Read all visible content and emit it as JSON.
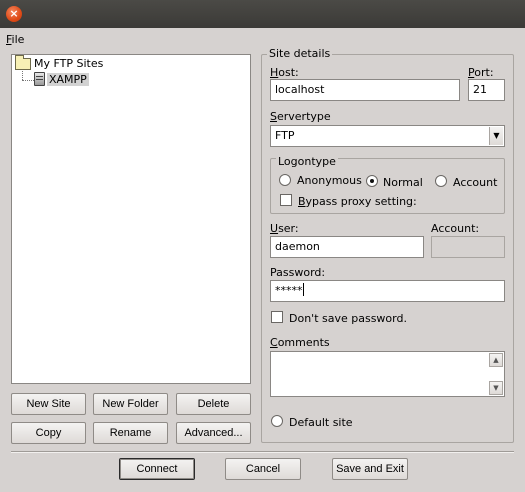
{
  "window": {
    "close_glyph": "×"
  },
  "menu": {
    "file": "File"
  },
  "tree": {
    "root_label": "My FTP Sites",
    "child_label": "XAMPP"
  },
  "left_buttons": {
    "new_site": "New Site",
    "new_folder": "New Folder",
    "delete": "Delete",
    "copy": "Copy",
    "rename": "Rename",
    "advanced": "Advanced..."
  },
  "site_details": {
    "group_label": "Site details",
    "host_label": "Host:",
    "host_value": "localhost",
    "port_label": "Port:",
    "port_value": "21",
    "servertype_label": "Servertype",
    "servertype_value": "FTP",
    "logontype_label": "Logontype",
    "logon_options": [
      "Anonymous",
      "Normal",
      "Account"
    ],
    "logon_selected": "Normal",
    "bypass_proxy_label": "Bypass proxy setting:",
    "bypass_proxy_checked": false,
    "user_label": "User:",
    "user_value": "daemon",
    "account_label": "Account:",
    "account_value": "",
    "password_label": "Password:",
    "password_value": "*****",
    "dont_save_password_label": "Don't save password.",
    "dont_save_password_checked": false,
    "comments_label": "Comments",
    "comments_value": "",
    "default_site_label": "Default site",
    "default_site_checked": false
  },
  "bottom_buttons": {
    "connect": "Connect",
    "cancel": "Cancel",
    "save_and_exit": "Save and Exit"
  },
  "colors": {
    "window_bg": "#d6d2d0",
    "titlebar": "#3b3a37",
    "close_button": "#df4a16",
    "selection": "#d2d2d2"
  },
  "icons": {
    "close": "close-icon",
    "folder": "folder-icon",
    "server": "server-icon",
    "dropdown": "chevron-down-icon",
    "scroll_up": "scroll-up-icon",
    "scroll_down": "scroll-down-icon"
  }
}
